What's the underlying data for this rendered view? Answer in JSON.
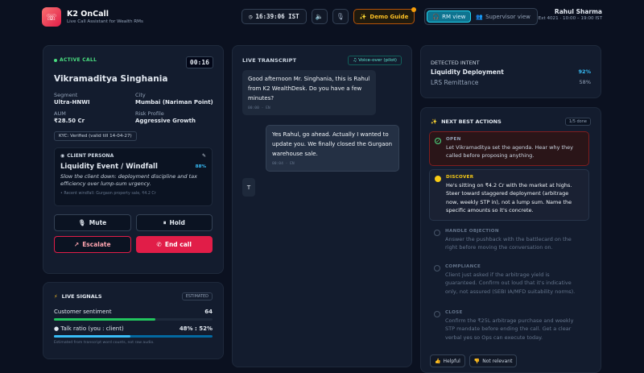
{
  "header": {
    "brand_title": "K2 OnCall",
    "brand_subtitle": "Live Call Assistant for Wealth RMs",
    "clock": "16:39:06 IST",
    "demo_guide": "Demo Guide",
    "view_rm": "RM view",
    "view_supervisor": "Supervisor view",
    "user_name": "Rahul Sharma",
    "user_ext": "Ext 4021 · 10:00 – 19:00 IST"
  },
  "call": {
    "status": "ACTIVE CALL",
    "timer": "00:16",
    "client_name": "Vikramaditya Singhania",
    "segment_label": "Segment",
    "segment_value": "Ultra-HNWI",
    "city_label": "City",
    "city_value": "Mumbai (Nariman Point)",
    "aum_label": "AUM",
    "aum_value": "₹28.50 Cr",
    "risk_label": "Risk Profile",
    "risk_value": "Aggressive Growth",
    "kyc": "KYC: Verified (valid till 14-04-27)",
    "persona_label": "CLIENT PERSONA",
    "persona_title": "Liquidity Event / Windfall",
    "persona_pct": "88%",
    "persona_desc": "Slow the client down: deployment discipline and tax efficiency over lump-sum urgency.",
    "persona_note": "• Recent windfall: Gurgaon property sale, ₹4.2 Cr",
    "mute": "Mute",
    "hold": "Hold",
    "escalate": "Escalate",
    "end_call": "End call"
  },
  "signals": {
    "title": "LIVE SIGNALS",
    "badge": "ESTIMATED",
    "sentiment_label": "Customer sentiment",
    "sentiment_value": "64",
    "sentiment_pct": 64,
    "talk_label": "Talk ratio (you : client)",
    "talk_value": "48% : 52%",
    "talk_pct": 48,
    "footnote": "Estimated from transcript word counts, not raw audio."
  },
  "transcript": {
    "title": "LIVE TRANSCRIPT",
    "badge": "Voice-over (pilot)",
    "messages": [
      {
        "text": "Good afternoon Mr. Singhania, this is Rahul from K2 WealthDesk. Do you have a few minutes?",
        "time": "00:00 · EN"
      },
      {
        "text": "Yes Rahul, go ahead. Actually I wanted to update you. We finally closed the Gurgaon warehouse sale.",
        "time": "00:04 · EN"
      }
    ],
    "typing": "T"
  },
  "intent": {
    "title": "DETECTED INTENT",
    "items": [
      {
        "label": "Liquidity Deployment",
        "value": "92%"
      },
      {
        "label": "LRS Remittance",
        "value": "58%"
      }
    ]
  },
  "nba": {
    "title": "NEXT BEST ACTIONS",
    "done": "1/5 done",
    "steps": [
      {
        "label": "OPEN",
        "text": "Let Vikramaditya set the agenda. Hear why they called before proposing anything."
      },
      {
        "label": "DISCOVER",
        "text": "He's sitting on ₹4.2 Cr with the market at highs. Steer toward staggered deployment (arbitrage now, weekly STP in), not a lump sum. Name the specific amounts so it's concrete."
      },
      {
        "label": "HANDLE OBJECTION",
        "text": "Answer the pushback with the battlecard on the right before moving the conversation on."
      },
      {
        "label": "COMPLIANCE",
        "text": "Client just asked if the arbitrage yield is guaranteed. Confirm out loud that it's indicative only, not assured (SEBI IA/MFD suitability norms)."
      },
      {
        "label": "CLOSE",
        "text": "Confirm the ₹25L arbitrage purchase and weekly STP mandate before ending the call. Get a clear verbal yes so Ops can execute today."
      }
    ],
    "helpful": "Helpful",
    "not_relevant": "Not relevant"
  }
}
